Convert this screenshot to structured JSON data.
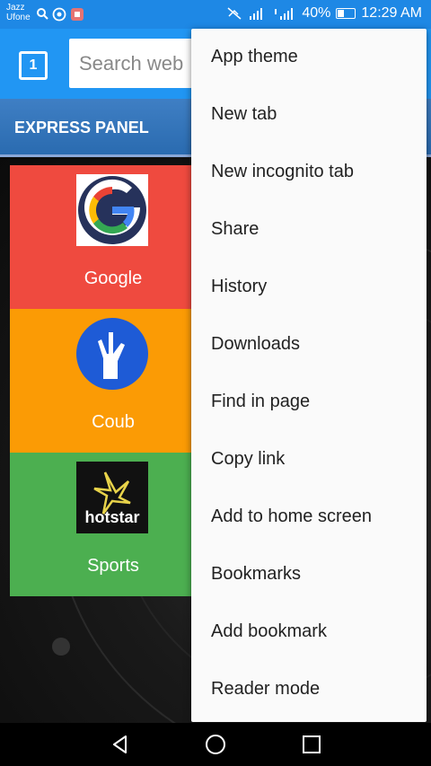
{
  "status_bar": {
    "carrier1": "Jazz",
    "carrier2": "Ufone",
    "battery": "40%",
    "time": "12:29 AM"
  },
  "toolbar": {
    "tab_count": "1",
    "search_placeholder": "Search web"
  },
  "panel": {
    "title": "EXPRESS PANEL"
  },
  "tiles": [
    {
      "label": "Google",
      "color": "#ef4a3f"
    },
    {
      "label": "Coub",
      "color": "#fb9b05"
    },
    {
      "label": "Sports",
      "color": "#4caf50",
      "icon_text": "hotstar"
    }
  ],
  "menu": {
    "items": [
      "App theme",
      "New tab",
      "New incognito tab",
      "Share",
      "History",
      "Downloads",
      "Find in page",
      "Copy link",
      "Add to home screen",
      "Bookmarks",
      "Add bookmark",
      "Reader mode"
    ]
  },
  "colors": {
    "accent": "#2196f3",
    "status_bar": "#1e88e5"
  }
}
